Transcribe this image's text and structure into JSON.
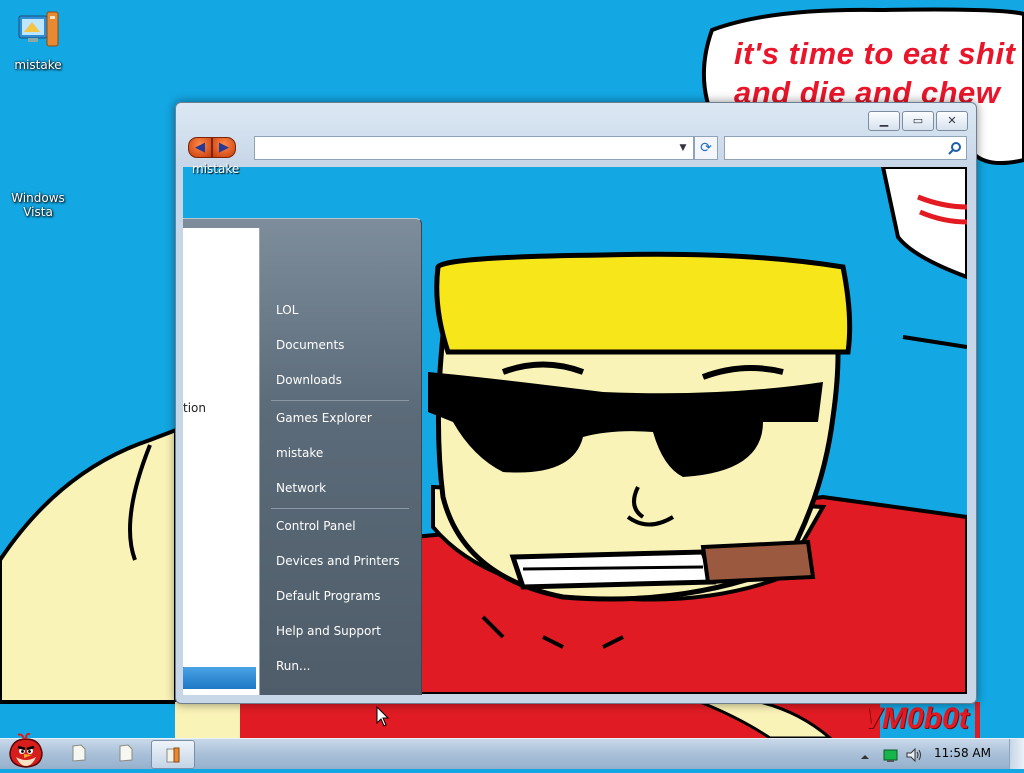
{
  "desktop": {
    "icons": [
      {
        "label": "mistake",
        "icon": "computer-folder-icon"
      },
      {
        "label": "Windows\nVista",
        "icon": "windows-logo-icon"
      }
    ],
    "speech_bubble": {
      "line1": "it's time to eat shit",
      "line2": "and die and chew"
    },
    "watermark": "VM0b0t"
  },
  "window": {
    "title": "",
    "address_value": "",
    "search_placeholder": "",
    "folder_label": "mistake",
    "caption_buttons": [
      "minimize",
      "maximize",
      "close"
    ]
  },
  "start_menu": {
    "left_fragment": "tion",
    "right_items": [
      {
        "label": "LOL",
        "group": 1
      },
      {
        "label": "Documents",
        "group": 1
      },
      {
        "label": "Downloads",
        "group": 1
      },
      {
        "label": "Games Explorer",
        "group": 2
      },
      {
        "label": "mistake",
        "group": 2
      },
      {
        "label": "Network",
        "group": 2
      },
      {
        "label": "Control Panel",
        "group": 3
      },
      {
        "label": "Devices and Printers",
        "group": 3
      },
      {
        "label": "Default Programs",
        "group": 3
      },
      {
        "label": "Help and Support",
        "group": 3
      },
      {
        "label": "Run...",
        "group": 4
      }
    ]
  },
  "taskbar": {
    "start_orb": "angry-bird-icon",
    "buttons": [
      "document-icon",
      "document-icon",
      "explorer-folder-icon"
    ],
    "clock": "11:58 AM",
    "tray_icons": [
      "tray-arrow-icon",
      "network-icon",
      "volume-icon"
    ]
  },
  "colors": {
    "desktop": "#13a7e3",
    "bubble_text": "#e9152a",
    "taskbar": "#a9c0d8"
  }
}
